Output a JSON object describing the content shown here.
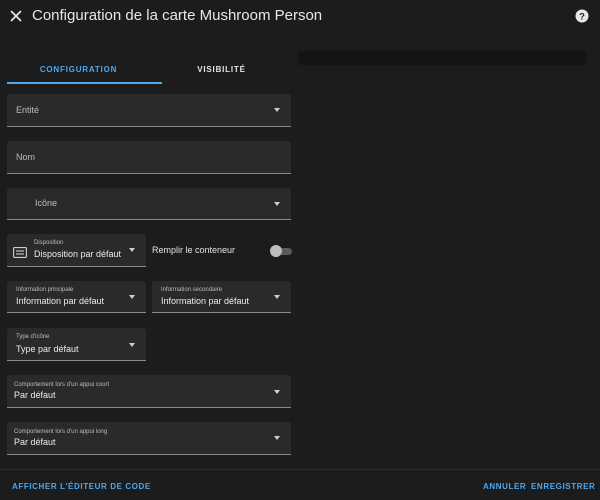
{
  "header": {
    "title": "Configuration de la carte Mushroom Person",
    "close_icon": "close-icon",
    "help_icon": "help-icon"
  },
  "tabs": [
    {
      "label": "CONFIGURATION",
      "active": true
    },
    {
      "label": "VISIBILITÉ",
      "active": false
    }
  ],
  "form": {
    "entity": {
      "label": "Entité"
    },
    "name": {
      "label": "Nom"
    },
    "icon": {
      "label": "Icône"
    },
    "layout": {
      "label": "Disposition",
      "value": "Disposition par défaut",
      "icon": "layout-icon"
    },
    "fill_container": {
      "label": "Remplir le conteneur",
      "checked": false
    },
    "primary_info": {
      "label": "Information principale",
      "value": "Information par défaut"
    },
    "secondary_info": {
      "label": "Information secondaire",
      "value": "Information par défaut"
    },
    "icon_type": {
      "label": "Type d'icône",
      "value": "Type par défaut"
    },
    "tap_action": {
      "label": "Comportement lors d'un appui court",
      "value": "Par défaut"
    },
    "hold_action": {
      "label": "Comportement lors d'un appui long",
      "value": "Par défaut"
    }
  },
  "footer": {
    "show_code_editor": "AFFICHER L'ÉDITEUR DE CODE",
    "cancel": "ANNULER",
    "save": "ENREGISTRER"
  },
  "colors": {
    "accent": "#4ca8ef",
    "background": "#1c1c1c",
    "field_background": "#2a2a2a"
  }
}
